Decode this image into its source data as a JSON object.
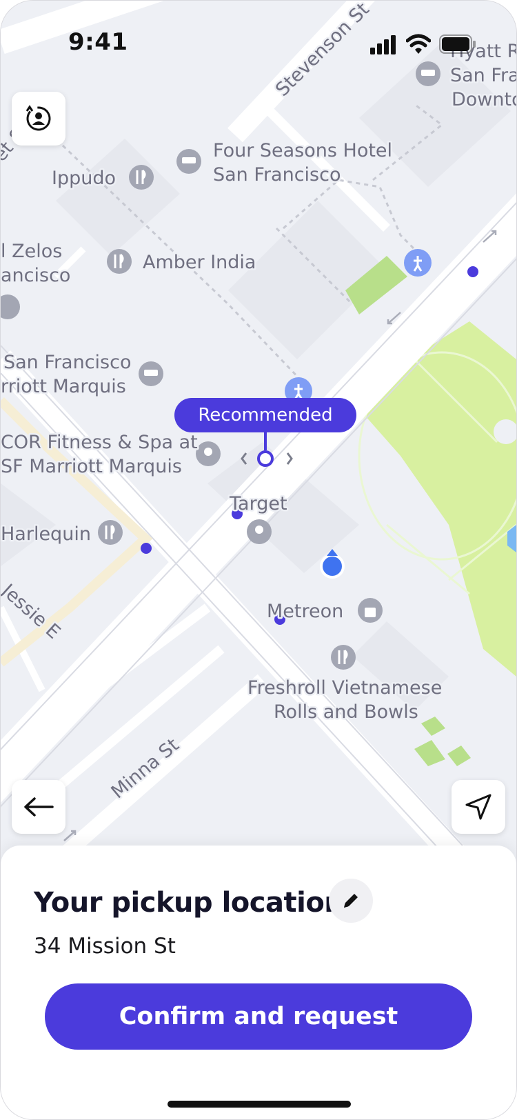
{
  "status_bar": {
    "time": "9:41"
  },
  "map": {
    "recommended_label": "Recommended",
    "streets": {
      "stevenson": "Stevenson St",
      "minna": "Minna St",
      "jessie": "Jessie E",
      "partial_left": "et S"
    },
    "pois": {
      "hyatt": [
        "Hyatt R",
        "San Fra",
        "Downto"
      ],
      "four_seasons": [
        "Four Seasons Hotel",
        "San Francisco"
      ],
      "ippudo": "Ippudo",
      "amber_india": "Amber India",
      "zelos": [
        "l Zelos",
        "ancisco"
      ],
      "marriott": [
        "San Francisco",
        "rriott Marquis"
      ],
      "fitness": [
        "COR Fitness & Spa at",
        "SF Marriott Marquis"
      ],
      "target": "Target",
      "harlequin": "Harlequin",
      "metreon": "Metreon",
      "freshroll": [
        "Freshroll Vietnamese",
        "Rolls and Bowls"
      ]
    },
    "colors": {
      "accent": "#4b3bdc",
      "park": "#d8f0a0",
      "road": "#ffffff",
      "background": "#eef0f5",
      "user_location": "#3f73f0"
    }
  },
  "controls": {
    "top_left_icon": "switch-rider-icon",
    "back_icon": "arrow-left-icon",
    "locate_icon": "navigation-arrow-icon"
  },
  "sheet": {
    "title": "Your pickup location",
    "address": "34 Mission St",
    "edit_icon": "pencil-icon",
    "confirm_label": "Confirm and request"
  }
}
